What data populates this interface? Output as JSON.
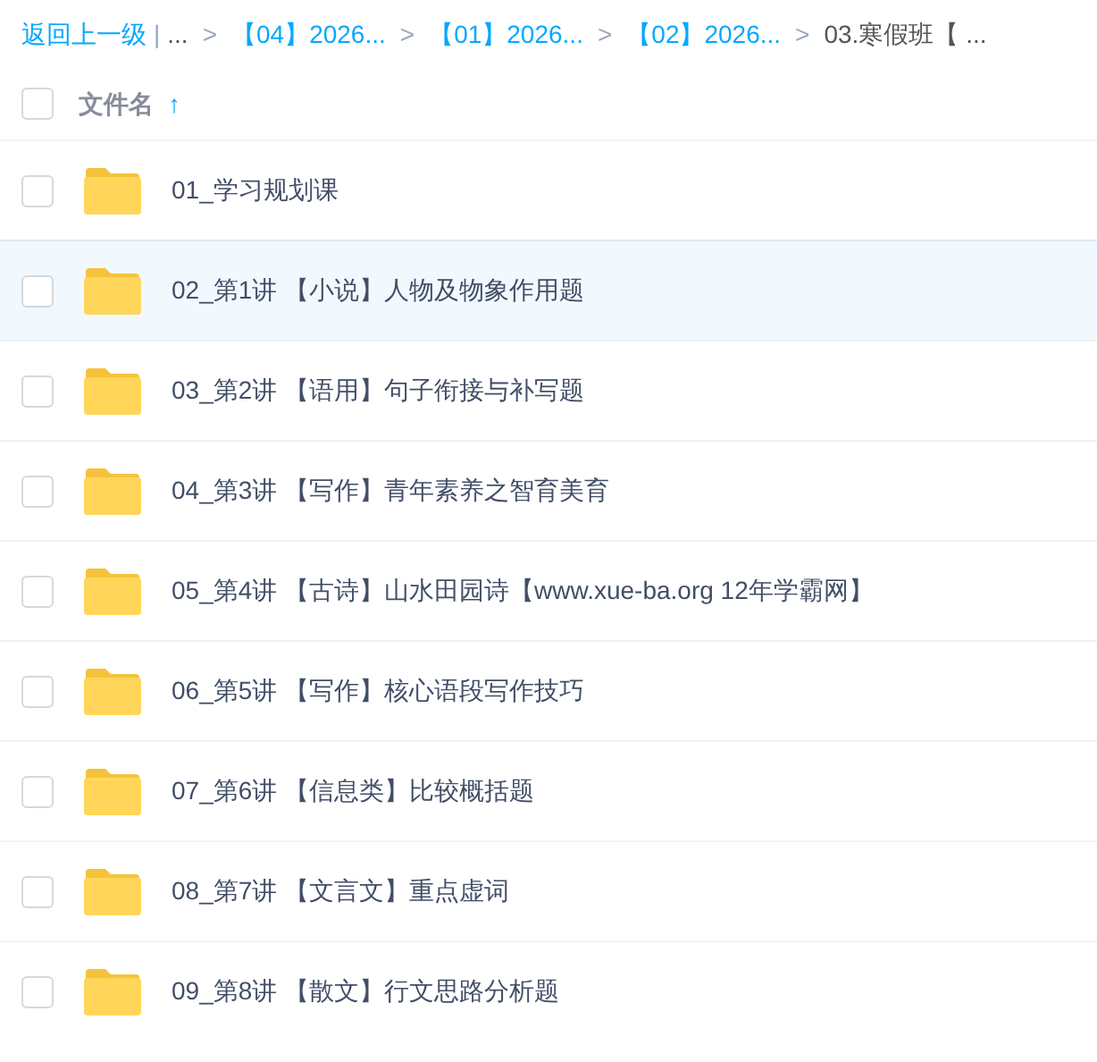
{
  "breadcrumb": [
    {
      "kind": "back",
      "label": "返回上一级"
    },
    {
      "kind": "divider",
      "label": "|"
    },
    {
      "kind": "text",
      "label": "..."
    },
    {
      "kind": "separator",
      "label": ">"
    },
    {
      "kind": "link",
      "label": "【04】2026..."
    },
    {
      "kind": "separator",
      "label": ">"
    },
    {
      "kind": "link",
      "label": "【01】2026..."
    },
    {
      "kind": "separator",
      "label": ">"
    },
    {
      "kind": "link",
      "label": "【02】2026..."
    },
    {
      "kind": "separator",
      "label": ">"
    },
    {
      "kind": "current",
      "label": "03.寒假班【 ..."
    }
  ],
  "header": {
    "checked": false,
    "label": "文件名",
    "sort_arrow": "↑"
  },
  "rows": [
    {
      "name": "01_学习规划课",
      "checked": false,
      "selected": false
    },
    {
      "name": "02_第1讲 【小说】人物及物象作用题",
      "checked": false,
      "selected": true
    },
    {
      "name": "03_第2讲 【语用】句子衔接与补写题",
      "checked": false,
      "selected": false
    },
    {
      "name": "04_第3讲 【写作】青年素养之智育美育",
      "checked": false,
      "selected": false
    },
    {
      "name": "05_第4讲 【古诗】山水田园诗【www.xue-ba.org 12年学霸网】",
      "checked": false,
      "selected": false
    },
    {
      "name": "06_第5讲 【写作】核心语段写作技巧",
      "checked": false,
      "selected": false
    },
    {
      "name": "07_第6讲 【信息类】比较概括题",
      "checked": false,
      "selected": false
    },
    {
      "name": "08_第7讲 【文言文】重点虚词",
      "checked": false,
      "selected": false
    },
    {
      "name": "09_第8讲 【散文】行文思路分析题",
      "checked": false,
      "selected": false
    }
  ]
}
